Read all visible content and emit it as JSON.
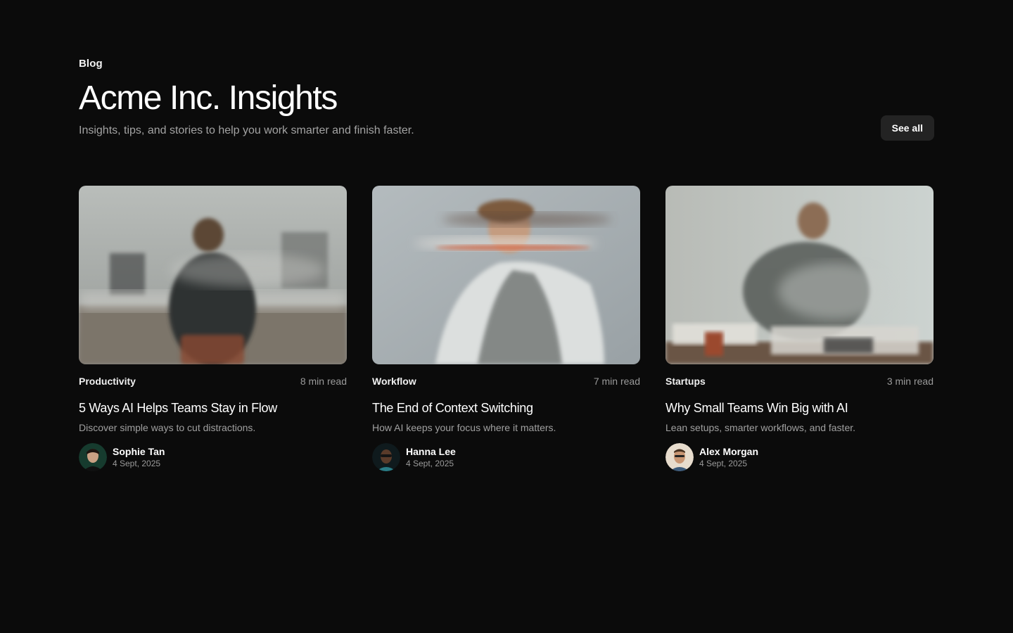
{
  "header": {
    "eyebrow": "Blog",
    "title": "Acme Inc. Insights",
    "subtitle": "Insights, tips, and stories to help you work smarter and finish faster.",
    "see_all_label": "See all"
  },
  "posts": [
    {
      "category": "Productivity",
      "read_time": "8 min read",
      "title": "5 Ways AI Helps Teams Stay in Flow",
      "description": "Discover simple ways to cut distractions.",
      "author": "Sophie Tan",
      "date": "4 Sept, 2025"
    },
    {
      "category": "Workflow",
      "read_time": "7 min read",
      "title": "The End of Context Switching",
      "description": "How AI keeps your focus where it matters.",
      "author": "Hanna Lee",
      "date": "4 Sept, 2025"
    },
    {
      "category": "Startups",
      "read_time": "3 min read",
      "title": "Why Small Teams Win Big with AI",
      "description": "Lean setups, smarter workflows, and faster.",
      "author": "Alex Morgan",
      "date": "4 Sept, 2025"
    }
  ],
  "colors": {
    "background": "#0b0b0b",
    "button_bg": "#232323",
    "muted_text": "#a3a3a3"
  }
}
